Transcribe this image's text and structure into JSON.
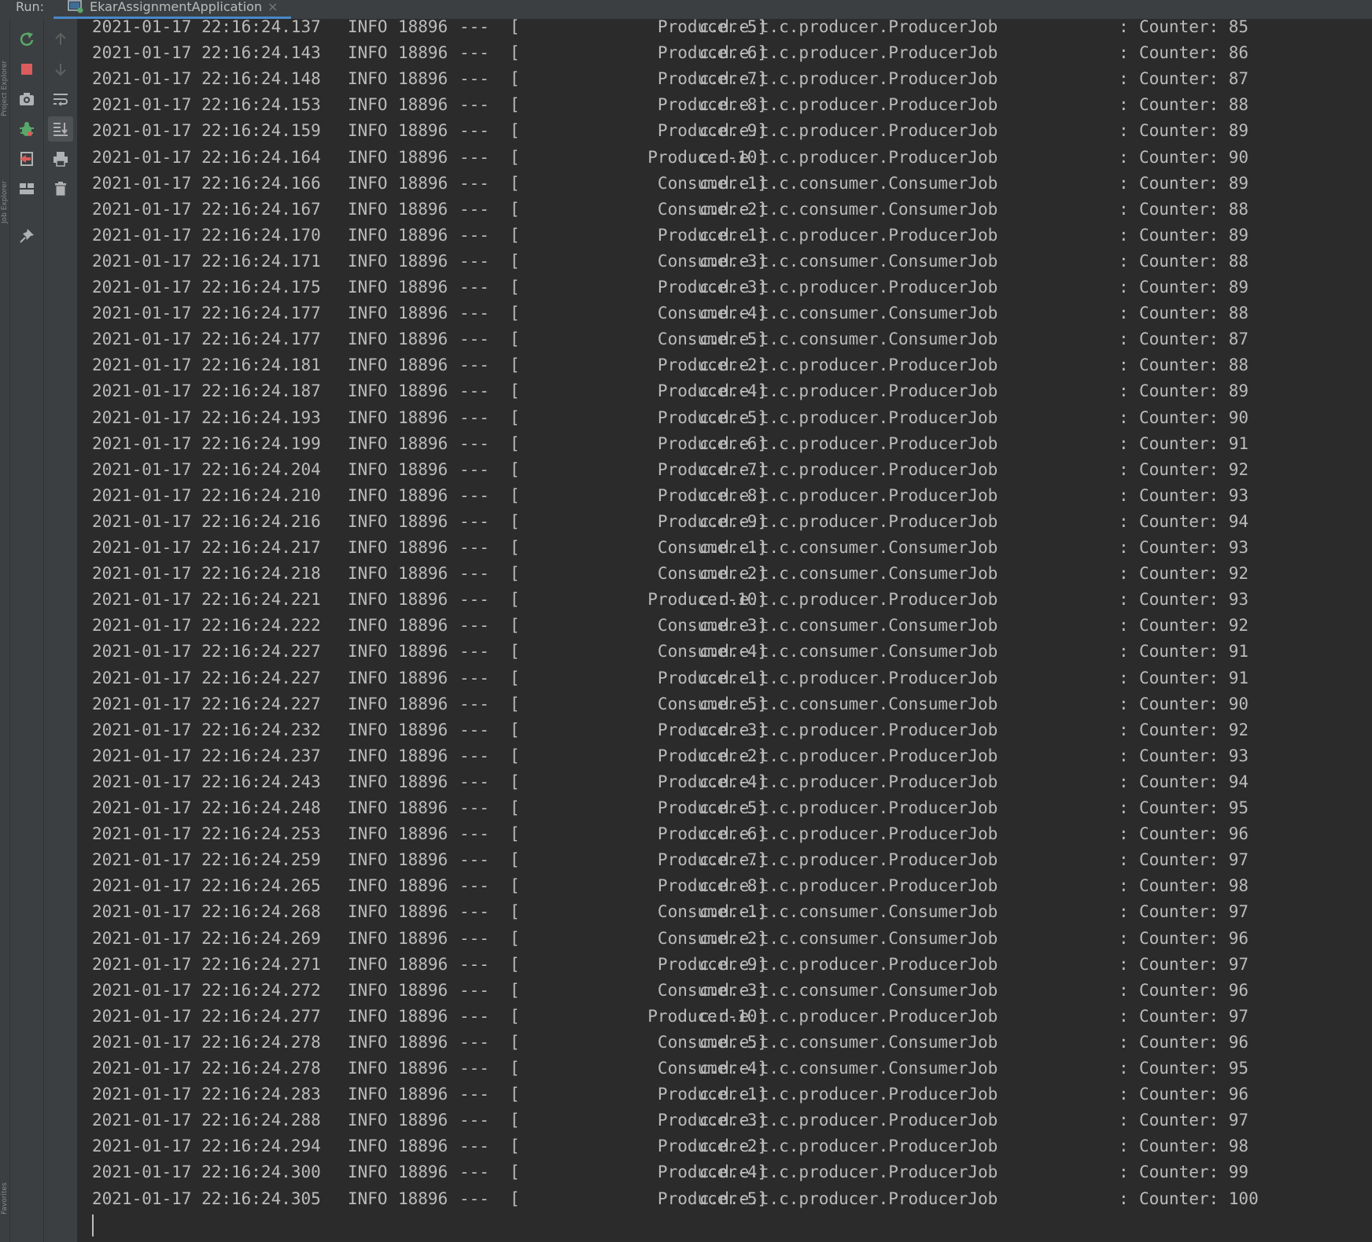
{
  "header": {
    "run_label": "Run:",
    "tab_title": "EkarAssignmentApplication",
    "tab_close": "×"
  },
  "side_labels": [
    "Project Explorer",
    "Job Explorer",
    "Favorites"
  ],
  "icons": {
    "toolbar_primary": [
      "rerun-icon",
      "stop-icon",
      "camera-icon",
      "debug-icon",
      "exit-icon",
      "layout-icon",
      "pin-icon"
    ],
    "toolbar_secondary": [
      "arrow-up-icon",
      "arrow-down-icon",
      "soft-wrap-icon",
      "scroll-to-end-icon",
      "print-icon",
      "trash-icon"
    ]
  },
  "colors": {
    "rerun": "#59a869",
    "stop": "#db5c5c",
    "accent": "#4a88c7",
    "console_bg": "#2b2b2b",
    "text": "#bbbbbb"
  },
  "logs": [
    {
      "ts": "2021-01-17 22:16:24.137",
      "level": "INFO",
      "pid": "18896",
      "sep": "---",
      "bracket": "[",
      "thread": "Producer-5]",
      "logger": "c.d.e.t.c.producer.ProducerJob",
      "colon": ":",
      "msg": "Counter: 85"
    },
    {
      "ts": "2021-01-17 22:16:24.143",
      "level": "INFO",
      "pid": "18896",
      "sep": "---",
      "bracket": "[",
      "thread": "Producer-6]",
      "logger": "c.d.e.t.c.producer.ProducerJob",
      "colon": ":",
      "msg": "Counter: 86"
    },
    {
      "ts": "2021-01-17 22:16:24.148",
      "level": "INFO",
      "pid": "18896",
      "sep": "---",
      "bracket": "[",
      "thread": "Producer-7]",
      "logger": "c.d.e.t.c.producer.ProducerJob",
      "colon": ":",
      "msg": "Counter: 87"
    },
    {
      "ts": "2021-01-17 22:16:24.153",
      "level": "INFO",
      "pid": "18896",
      "sep": "---",
      "bracket": "[",
      "thread": "Producer-8]",
      "logger": "c.d.e.t.c.producer.ProducerJob",
      "colon": ":",
      "msg": "Counter: 88"
    },
    {
      "ts": "2021-01-17 22:16:24.159",
      "level": "INFO",
      "pid": "18896",
      "sep": "---",
      "bracket": "[",
      "thread": "Producer-9]",
      "logger": "c.d.e.t.c.producer.ProducerJob",
      "colon": ":",
      "msg": "Counter: 89"
    },
    {
      "ts": "2021-01-17 22:16:24.164",
      "level": "INFO",
      "pid": "18896",
      "sep": "---",
      "bracket": "[",
      "thread": "Producer-10]",
      "logger": "c.d.e.t.c.producer.ProducerJob",
      "colon": ":",
      "msg": "Counter: 90"
    },
    {
      "ts": "2021-01-17 22:16:24.166",
      "level": "INFO",
      "pid": "18896",
      "sep": "---",
      "bracket": "[",
      "thread": "Consumer-1]",
      "logger": "c.d.e.t.c.consumer.ConsumerJob",
      "colon": ":",
      "msg": "Counter: 89"
    },
    {
      "ts": "2021-01-17 22:16:24.167",
      "level": "INFO",
      "pid": "18896",
      "sep": "---",
      "bracket": "[",
      "thread": "Consumer-2]",
      "logger": "c.d.e.t.c.consumer.ConsumerJob",
      "colon": ":",
      "msg": "Counter: 88"
    },
    {
      "ts": "2021-01-17 22:16:24.170",
      "level": "INFO",
      "pid": "18896",
      "sep": "---",
      "bracket": "[",
      "thread": "Producer-1]",
      "logger": "c.d.e.t.c.producer.ProducerJob",
      "colon": ":",
      "msg": "Counter: 89"
    },
    {
      "ts": "2021-01-17 22:16:24.171",
      "level": "INFO",
      "pid": "18896",
      "sep": "---",
      "bracket": "[",
      "thread": "Consumer-3]",
      "logger": "c.d.e.t.c.consumer.ConsumerJob",
      "colon": ":",
      "msg": "Counter: 88"
    },
    {
      "ts": "2021-01-17 22:16:24.175",
      "level": "INFO",
      "pid": "18896",
      "sep": "---",
      "bracket": "[",
      "thread": "Producer-3]",
      "logger": "c.d.e.t.c.producer.ProducerJob",
      "colon": ":",
      "msg": "Counter: 89"
    },
    {
      "ts": "2021-01-17 22:16:24.177",
      "level": "INFO",
      "pid": "18896",
      "sep": "---",
      "bracket": "[",
      "thread": "Consumer-4]",
      "logger": "c.d.e.t.c.consumer.ConsumerJob",
      "colon": ":",
      "msg": "Counter: 88"
    },
    {
      "ts": "2021-01-17 22:16:24.177",
      "level": "INFO",
      "pid": "18896",
      "sep": "---",
      "bracket": "[",
      "thread": "Consumer-5]",
      "logger": "c.d.e.t.c.consumer.ConsumerJob",
      "colon": ":",
      "msg": "Counter: 87"
    },
    {
      "ts": "2021-01-17 22:16:24.181",
      "level": "INFO",
      "pid": "18896",
      "sep": "---",
      "bracket": "[",
      "thread": "Producer-2]",
      "logger": "c.d.e.t.c.producer.ProducerJob",
      "colon": ":",
      "msg": "Counter: 88"
    },
    {
      "ts": "2021-01-17 22:16:24.187",
      "level": "INFO",
      "pid": "18896",
      "sep": "---",
      "bracket": "[",
      "thread": "Producer-4]",
      "logger": "c.d.e.t.c.producer.ProducerJob",
      "colon": ":",
      "msg": "Counter: 89"
    },
    {
      "ts": "2021-01-17 22:16:24.193",
      "level": "INFO",
      "pid": "18896",
      "sep": "---",
      "bracket": "[",
      "thread": "Producer-5]",
      "logger": "c.d.e.t.c.producer.ProducerJob",
      "colon": ":",
      "msg": "Counter: 90"
    },
    {
      "ts": "2021-01-17 22:16:24.199",
      "level": "INFO",
      "pid": "18896",
      "sep": "---",
      "bracket": "[",
      "thread": "Producer-6]",
      "logger": "c.d.e.t.c.producer.ProducerJob",
      "colon": ":",
      "msg": "Counter: 91"
    },
    {
      "ts": "2021-01-17 22:16:24.204",
      "level": "INFO",
      "pid": "18896",
      "sep": "---",
      "bracket": "[",
      "thread": "Producer-7]",
      "logger": "c.d.e.t.c.producer.ProducerJob",
      "colon": ":",
      "msg": "Counter: 92"
    },
    {
      "ts": "2021-01-17 22:16:24.210",
      "level": "INFO",
      "pid": "18896",
      "sep": "---",
      "bracket": "[",
      "thread": "Producer-8]",
      "logger": "c.d.e.t.c.producer.ProducerJob",
      "colon": ":",
      "msg": "Counter: 93"
    },
    {
      "ts": "2021-01-17 22:16:24.216",
      "level": "INFO",
      "pid": "18896",
      "sep": "---",
      "bracket": "[",
      "thread": "Producer-9]",
      "logger": "c.d.e.t.c.producer.ProducerJob",
      "colon": ":",
      "msg": "Counter: 94"
    },
    {
      "ts": "2021-01-17 22:16:24.217",
      "level": "INFO",
      "pid": "18896",
      "sep": "---",
      "bracket": "[",
      "thread": "Consumer-1]",
      "logger": "c.d.e.t.c.consumer.ConsumerJob",
      "colon": ":",
      "msg": "Counter: 93"
    },
    {
      "ts": "2021-01-17 22:16:24.218",
      "level": "INFO",
      "pid": "18896",
      "sep": "---",
      "bracket": "[",
      "thread": "Consumer-2]",
      "logger": "c.d.e.t.c.consumer.ConsumerJob",
      "colon": ":",
      "msg": "Counter: 92"
    },
    {
      "ts": "2021-01-17 22:16:24.221",
      "level": "INFO",
      "pid": "18896",
      "sep": "---",
      "bracket": "[",
      "thread": "Producer-10]",
      "logger": "c.d.e.t.c.producer.ProducerJob",
      "colon": ":",
      "msg": "Counter: 93"
    },
    {
      "ts": "2021-01-17 22:16:24.222",
      "level": "INFO",
      "pid": "18896",
      "sep": "---",
      "bracket": "[",
      "thread": "Consumer-3]",
      "logger": "c.d.e.t.c.consumer.ConsumerJob",
      "colon": ":",
      "msg": "Counter: 92"
    },
    {
      "ts": "2021-01-17 22:16:24.227",
      "level": "INFO",
      "pid": "18896",
      "sep": "---",
      "bracket": "[",
      "thread": "Consumer-4]",
      "logger": "c.d.e.t.c.consumer.ConsumerJob",
      "colon": ":",
      "msg": "Counter: 91"
    },
    {
      "ts": "2021-01-17 22:16:24.227",
      "level": "INFO",
      "pid": "18896",
      "sep": "---",
      "bracket": "[",
      "thread": "Producer-1]",
      "logger": "c.d.e.t.c.producer.ProducerJob",
      "colon": ":",
      "msg": "Counter: 91"
    },
    {
      "ts": "2021-01-17 22:16:24.227",
      "level": "INFO",
      "pid": "18896",
      "sep": "---",
      "bracket": "[",
      "thread": "Consumer-5]",
      "logger": "c.d.e.t.c.consumer.ConsumerJob",
      "colon": ":",
      "msg": "Counter: 90"
    },
    {
      "ts": "2021-01-17 22:16:24.232",
      "level": "INFO",
      "pid": "18896",
      "sep": "---",
      "bracket": "[",
      "thread": "Producer-3]",
      "logger": "c.d.e.t.c.producer.ProducerJob",
      "colon": ":",
      "msg": "Counter: 92"
    },
    {
      "ts": "2021-01-17 22:16:24.237",
      "level": "INFO",
      "pid": "18896",
      "sep": "---",
      "bracket": "[",
      "thread": "Producer-2]",
      "logger": "c.d.e.t.c.producer.ProducerJob",
      "colon": ":",
      "msg": "Counter: 93"
    },
    {
      "ts": "2021-01-17 22:16:24.243",
      "level": "INFO",
      "pid": "18896",
      "sep": "---",
      "bracket": "[",
      "thread": "Producer-4]",
      "logger": "c.d.e.t.c.producer.ProducerJob",
      "colon": ":",
      "msg": "Counter: 94"
    },
    {
      "ts": "2021-01-17 22:16:24.248",
      "level": "INFO",
      "pid": "18896",
      "sep": "---",
      "bracket": "[",
      "thread": "Producer-5]",
      "logger": "c.d.e.t.c.producer.ProducerJob",
      "colon": ":",
      "msg": "Counter: 95"
    },
    {
      "ts": "2021-01-17 22:16:24.253",
      "level": "INFO",
      "pid": "18896",
      "sep": "---",
      "bracket": "[",
      "thread": "Producer-6]",
      "logger": "c.d.e.t.c.producer.ProducerJob",
      "colon": ":",
      "msg": "Counter: 96"
    },
    {
      "ts": "2021-01-17 22:16:24.259",
      "level": "INFO",
      "pid": "18896",
      "sep": "---",
      "bracket": "[",
      "thread": "Producer-7]",
      "logger": "c.d.e.t.c.producer.ProducerJob",
      "colon": ":",
      "msg": "Counter: 97"
    },
    {
      "ts": "2021-01-17 22:16:24.265",
      "level": "INFO",
      "pid": "18896",
      "sep": "---",
      "bracket": "[",
      "thread": "Producer-8]",
      "logger": "c.d.e.t.c.producer.ProducerJob",
      "colon": ":",
      "msg": "Counter: 98"
    },
    {
      "ts": "2021-01-17 22:16:24.268",
      "level": "INFO",
      "pid": "18896",
      "sep": "---",
      "bracket": "[",
      "thread": "Consumer-1]",
      "logger": "c.d.e.t.c.consumer.ConsumerJob",
      "colon": ":",
      "msg": "Counter: 97"
    },
    {
      "ts": "2021-01-17 22:16:24.269",
      "level": "INFO",
      "pid": "18896",
      "sep": "---",
      "bracket": "[",
      "thread": "Consumer-2]",
      "logger": "c.d.e.t.c.consumer.ConsumerJob",
      "colon": ":",
      "msg": "Counter: 96"
    },
    {
      "ts": "2021-01-17 22:16:24.271",
      "level": "INFO",
      "pid": "18896",
      "sep": "---",
      "bracket": "[",
      "thread": "Producer-9]",
      "logger": "c.d.e.t.c.producer.ProducerJob",
      "colon": ":",
      "msg": "Counter: 97"
    },
    {
      "ts": "2021-01-17 22:16:24.272",
      "level": "INFO",
      "pid": "18896",
      "sep": "---",
      "bracket": "[",
      "thread": "Consumer-3]",
      "logger": "c.d.e.t.c.consumer.ConsumerJob",
      "colon": ":",
      "msg": "Counter: 96"
    },
    {
      "ts": "2021-01-17 22:16:24.277",
      "level": "INFO",
      "pid": "18896",
      "sep": "---",
      "bracket": "[",
      "thread": "Producer-10]",
      "logger": "c.d.e.t.c.producer.ProducerJob",
      "colon": ":",
      "msg": "Counter: 97"
    },
    {
      "ts": "2021-01-17 22:16:24.278",
      "level": "INFO",
      "pid": "18896",
      "sep": "---",
      "bracket": "[",
      "thread": "Consumer-5]",
      "logger": "c.d.e.t.c.consumer.ConsumerJob",
      "colon": ":",
      "msg": "Counter: 96"
    },
    {
      "ts": "2021-01-17 22:16:24.278",
      "level": "INFO",
      "pid": "18896",
      "sep": "---",
      "bracket": "[",
      "thread": "Consumer-4]",
      "logger": "c.d.e.t.c.consumer.ConsumerJob",
      "colon": ":",
      "msg": "Counter: 95"
    },
    {
      "ts": "2021-01-17 22:16:24.283",
      "level": "INFO",
      "pid": "18896",
      "sep": "---",
      "bracket": "[",
      "thread": "Producer-1]",
      "logger": "c.d.e.t.c.producer.ProducerJob",
      "colon": ":",
      "msg": "Counter: 96"
    },
    {
      "ts": "2021-01-17 22:16:24.288",
      "level": "INFO",
      "pid": "18896",
      "sep": "---",
      "bracket": "[",
      "thread": "Producer-3]",
      "logger": "c.d.e.t.c.producer.ProducerJob",
      "colon": ":",
      "msg": "Counter: 97"
    },
    {
      "ts": "2021-01-17 22:16:24.294",
      "level": "INFO",
      "pid": "18896",
      "sep": "---",
      "bracket": "[",
      "thread": "Producer-2]",
      "logger": "c.d.e.t.c.producer.ProducerJob",
      "colon": ":",
      "msg": "Counter: 98"
    },
    {
      "ts": "2021-01-17 22:16:24.300",
      "level": "INFO",
      "pid": "18896",
      "sep": "---",
      "bracket": "[",
      "thread": "Producer-4]",
      "logger": "c.d.e.t.c.producer.ProducerJob",
      "colon": ":",
      "msg": "Counter: 99"
    },
    {
      "ts": "2021-01-17 22:16:24.305",
      "level": "INFO",
      "pid": "18896",
      "sep": "---",
      "bracket": "[",
      "thread": "Producer-5]",
      "logger": "c.d.e.t.c.producer.ProducerJob",
      "colon": ":",
      "msg": "Counter: 100"
    }
  ]
}
